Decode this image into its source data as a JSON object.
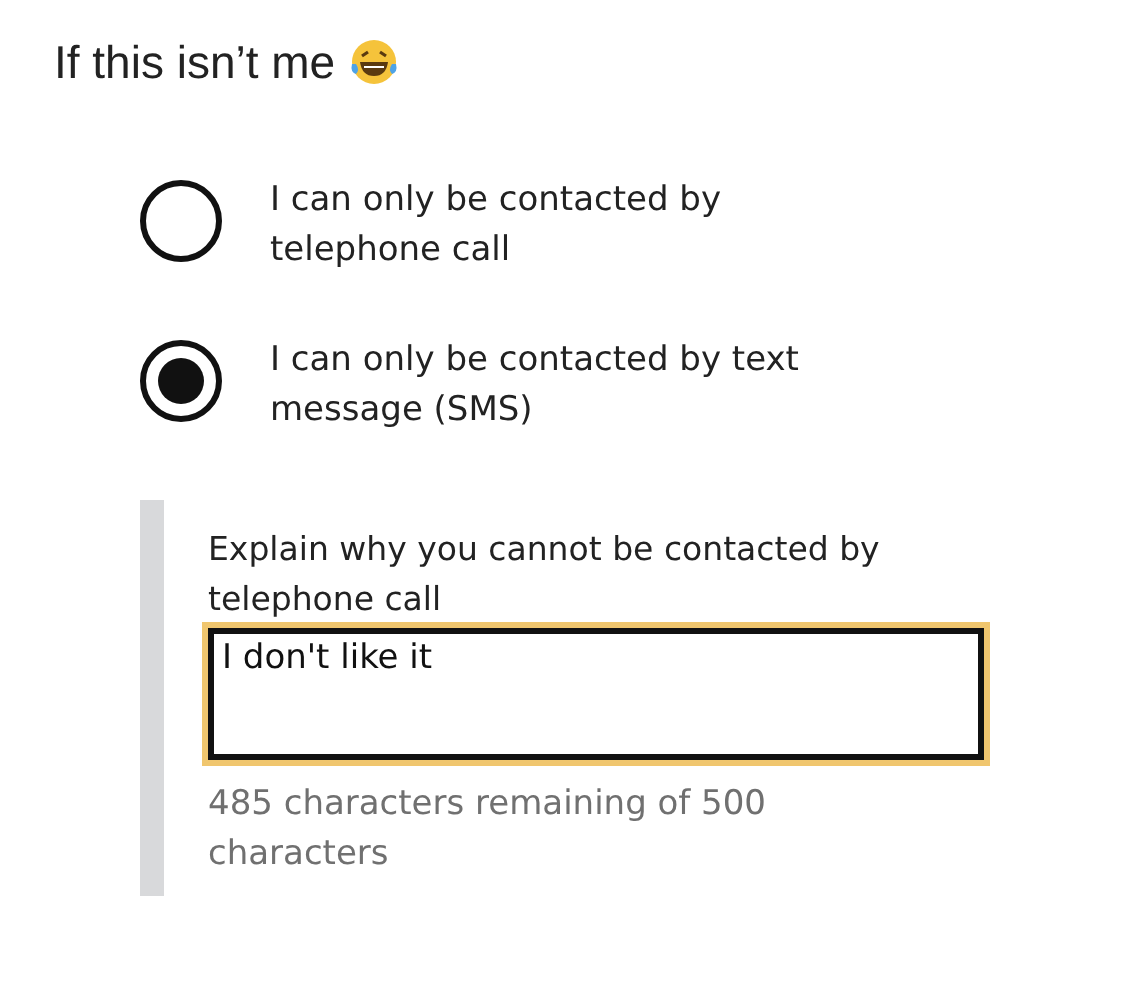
{
  "caption": {
    "text": "If this isn’t me"
  },
  "radios": [
    {
      "label": "I can only be contacted by telephone call",
      "selected": false
    },
    {
      "label": "I can only be contacted by text message (SMS)",
      "selected": true
    }
  ],
  "explanation": {
    "label": "Explain why you cannot be contacted by telephone call",
    "value": "I don't like it",
    "focused": true,
    "hint": "485 characters remaining of 500 characters"
  }
}
